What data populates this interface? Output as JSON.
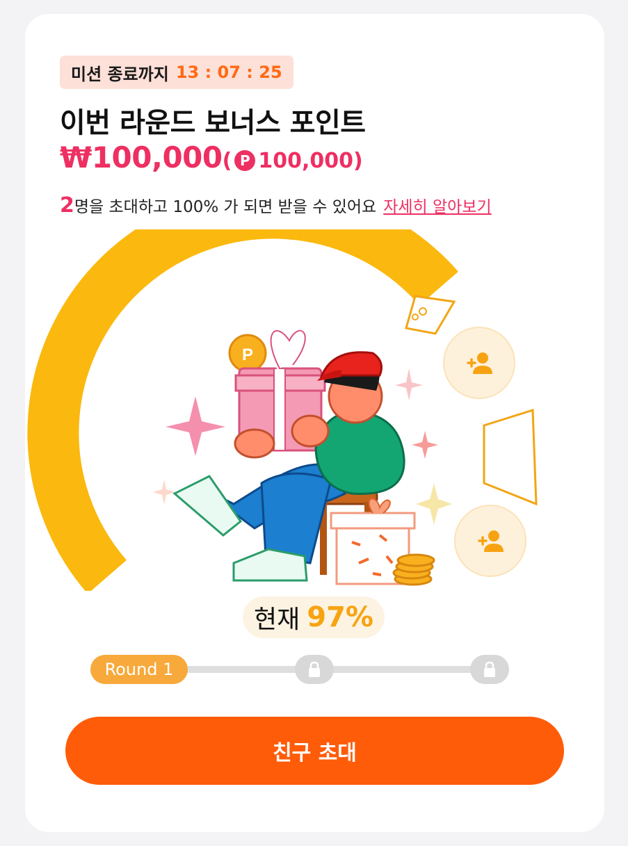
{
  "mission": {
    "label": "미션 종료까지",
    "countdown": "13 : 07 : 25"
  },
  "title": "이번 라운드 보너스 포인트",
  "bonus": {
    "won": "₩100,000",
    "paren_open": "(",
    "point_symbol": "P",
    "points": "100,000",
    "paren_close": ")"
  },
  "description": {
    "count": "2",
    "text": "명을 초대하고 100% 가 되면 받을 수 있어요",
    "link": "자세히 알아보기"
  },
  "illustration": {
    "coin_symbol": "P"
  },
  "progress": {
    "label": "현재",
    "value": "97%",
    "fraction": 0.97
  },
  "rounds": [
    {
      "label": "Round 1",
      "locked": false
    },
    {
      "label": "",
      "locked": true,
      "icon": "lock-icon"
    },
    {
      "label": "",
      "locked": true,
      "icon": "lock-icon"
    }
  ],
  "invite_slots": [
    {
      "icon": "add-person-icon"
    },
    {
      "icon": "add-person-icon"
    }
  ],
  "cta": {
    "label": "친구 초대"
  },
  "colors": {
    "accent": "#ff5c0a",
    "pink": "#ee2f62",
    "gauge": "#fbb80e",
    "badge": "#f7a93b"
  }
}
